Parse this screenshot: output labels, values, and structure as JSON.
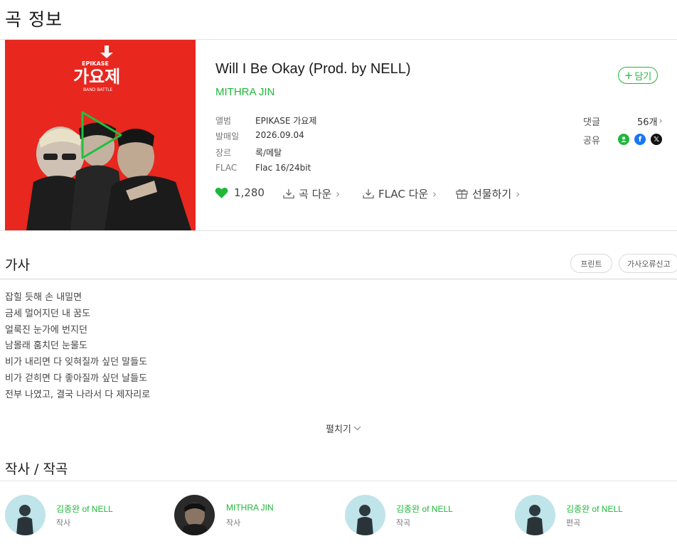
{
  "page": {
    "title": "곡 정보"
  },
  "song": {
    "title": "Will I Be Okay (Prod. by NELL)",
    "artist": "MITHRA JIN",
    "cover": {
      "logo_small": "EPIKASE",
      "logo_text": "가요제",
      "logo_sub": "BAND BATTLE",
      "bg_color": "#e8271f"
    },
    "meta": [
      {
        "key": "앨범",
        "value": "EPIKASE 가요제"
      },
      {
        "key": "발매일",
        "value": "2026.09.04"
      },
      {
        "key": "장르",
        "value": "록/메탈"
      },
      {
        "key": "FLAC",
        "value": "Flac 16/24bit"
      }
    ],
    "add_label": "담기",
    "comments": {
      "label": "댓글",
      "count": "56개"
    },
    "share": {
      "label": "공유",
      "icons": [
        "melon-icon",
        "facebook-icon",
        "x-icon"
      ]
    },
    "likes": "1,280",
    "actions": {
      "download": "곡 다운",
      "flac_download": "FLAC 다운",
      "gift": "선물하기"
    }
  },
  "lyrics": {
    "title": "가사",
    "print_label": "프린트",
    "report_label": "가사오류신고",
    "lines": [
      "잡힐 듯해 손 내밀면",
      "금세 멀어지던 내 꿈도",
      "얼룩진 눈가에 번지던",
      "남몰래 훔치던 눈물도",
      "비가 내리면 다 잊혀질까 싶던 말들도",
      "비가 걷히면 다 좋아질까 싶던 날들도",
      "전부 나였고, 결국 나라서 다 제자리로"
    ],
    "expand_label": "펼치기"
  },
  "credits": {
    "title": "작사 / 작곡",
    "people": [
      {
        "name": "김종완 of NELL",
        "role": "작사"
      },
      {
        "name": "MITHRA JIN",
        "role": "작사"
      },
      {
        "name": "김종완 of NELL",
        "role": "작곡"
      },
      {
        "name": "김종완 of NELL",
        "role": "편곡"
      }
    ]
  },
  "colors": {
    "accent": "#1fb73a",
    "facebook": "#1877f2",
    "x": "#111111",
    "heart": "#1fb73a"
  }
}
